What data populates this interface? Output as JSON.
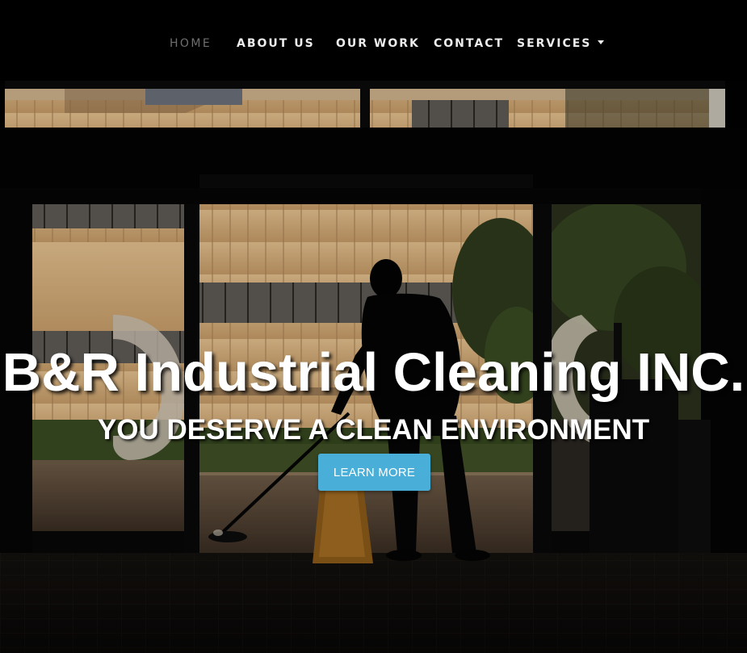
{
  "nav": {
    "items": [
      {
        "label": "HOME",
        "active": true
      },
      {
        "label": "ABOUT US",
        "active": false
      },
      {
        "label": "OUR WORK",
        "active": false
      },
      {
        "label": "CONTACT",
        "active": false
      },
      {
        "label": "SERVICES",
        "active": false,
        "has_dropdown": true
      }
    ]
  },
  "hero": {
    "title": "B&R Industrial Cleaning INC.",
    "subtitle": "YOU DESERVE A CLEAN ENVIRONMENT",
    "button_label": "LEARN MORE",
    "background_description_icon": "janitor-mopping-silhouette-image"
  },
  "colors": {
    "nav_background": "#000000",
    "nav_text": "#ececec",
    "nav_active_text": "#6f6f6f",
    "button_background": "#49aed8",
    "hero_text": "#ffffff"
  }
}
